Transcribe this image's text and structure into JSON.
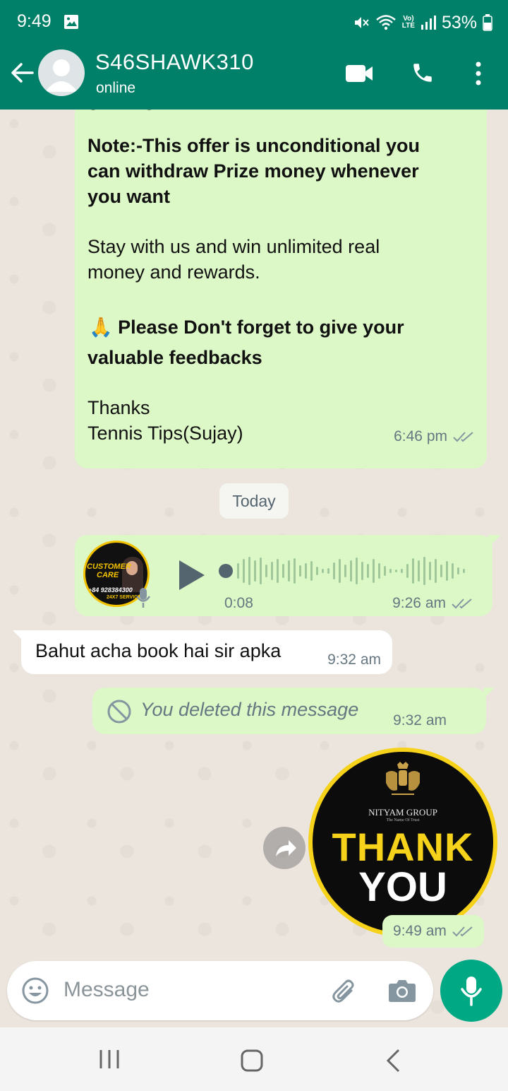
{
  "status_bar": {
    "time": "9:49",
    "lte_top": "Vo)",
    "lte_bottom": "LTE",
    "battery": "53%"
  },
  "header": {
    "contact_name": "S46SHAWK310",
    "contact_status": "online"
  },
  "messages": {
    "promo": {
      "cut_word": "gaming",
      "note_line1": "Note:-This offer is unconditional you",
      "note_line2": "can withdraw Prize money whenever",
      "note_line3": "you want",
      "stay_line1": "Stay with us and win unlimited real",
      "stay_line2": "money and rewards.",
      "pray_emoji": "🙏",
      "feedback_line1": "Please Don't forget to give your",
      "feedback_line2": "valuable feedbacks",
      "thanks": "Thanks",
      "signature": "Tennis Tips(Sujay)",
      "time": "6:46 pm"
    },
    "date_divider": "Today",
    "voice": {
      "avatar_text_1": "CUSTOMER",
      "avatar_text_2": "CARE",
      "avatar_phone": "+84 928384300",
      "avatar_service": "24X7 SERVICE",
      "duration": "0:08",
      "time": "9:26 am"
    },
    "incoming": {
      "text": "Bahut acha book hai sir apka",
      "time": "9:32 am"
    },
    "deleted": {
      "text": "You deleted this message",
      "time": "9:32 am"
    },
    "sticker": {
      "brand": "NITYAM GROUP",
      "tagline": "The Name Of Trust",
      "line1": "THANK",
      "line2": "YOU",
      "time": "9:49 am"
    }
  },
  "composer": {
    "placeholder": "Message"
  },
  "colors": {
    "header": "#008069",
    "outgoing_bubble": "#dcf8c6",
    "incoming_bubble": "#ffffff",
    "mic_button": "#00a884",
    "read_ticks": "#8696a0"
  },
  "icons": [
    "back-arrow-icon",
    "avatar-placeholder-icon",
    "video-call-icon",
    "phone-icon",
    "more-vert-icon",
    "play-icon",
    "mic-icon",
    "blocked-icon",
    "forward-icon",
    "emoji-icon",
    "attach-icon",
    "camera-icon",
    "recents-icon",
    "home-icon",
    "nav-back-icon"
  ]
}
